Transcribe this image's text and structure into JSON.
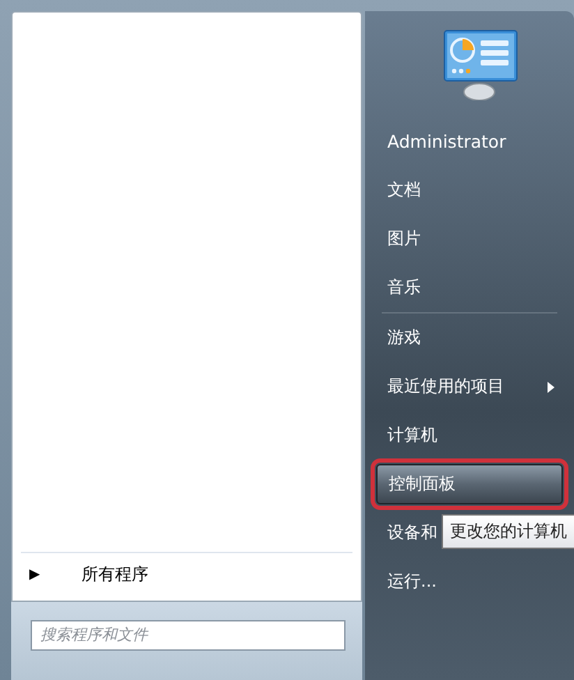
{
  "left_panel": {
    "all_programs": {
      "arrow": "▶",
      "label": "所有程序"
    },
    "search": {
      "placeholder": "搜索程序和文件"
    }
  },
  "right_panel": {
    "user": {
      "name": "Administrator"
    },
    "items": [
      {
        "label": "文档",
        "kind": "item",
        "selected": false,
        "separator_before": false
      },
      {
        "label": "图片",
        "kind": "item",
        "selected": false,
        "separator_before": false
      },
      {
        "label": "音乐",
        "kind": "item",
        "selected": false,
        "separator_before": false
      },
      {
        "label": "游戏",
        "kind": "item",
        "selected": false,
        "separator_before": true
      },
      {
        "label": "最近使用的项目",
        "kind": "submenu",
        "selected": false,
        "separator_before": false
      },
      {
        "label": "计算机",
        "kind": "item",
        "selected": false,
        "separator_before": false
      },
      {
        "label": "控制面板",
        "kind": "item",
        "selected": true,
        "separator_before": false
      },
      {
        "label": "设备和",
        "kind": "item",
        "selected": false,
        "separator_before": false
      },
      {
        "label": "运行...",
        "kind": "item",
        "selected": false,
        "separator_before": false
      }
    ]
  },
  "tooltip": {
    "text": "更改您的计算机"
  }
}
